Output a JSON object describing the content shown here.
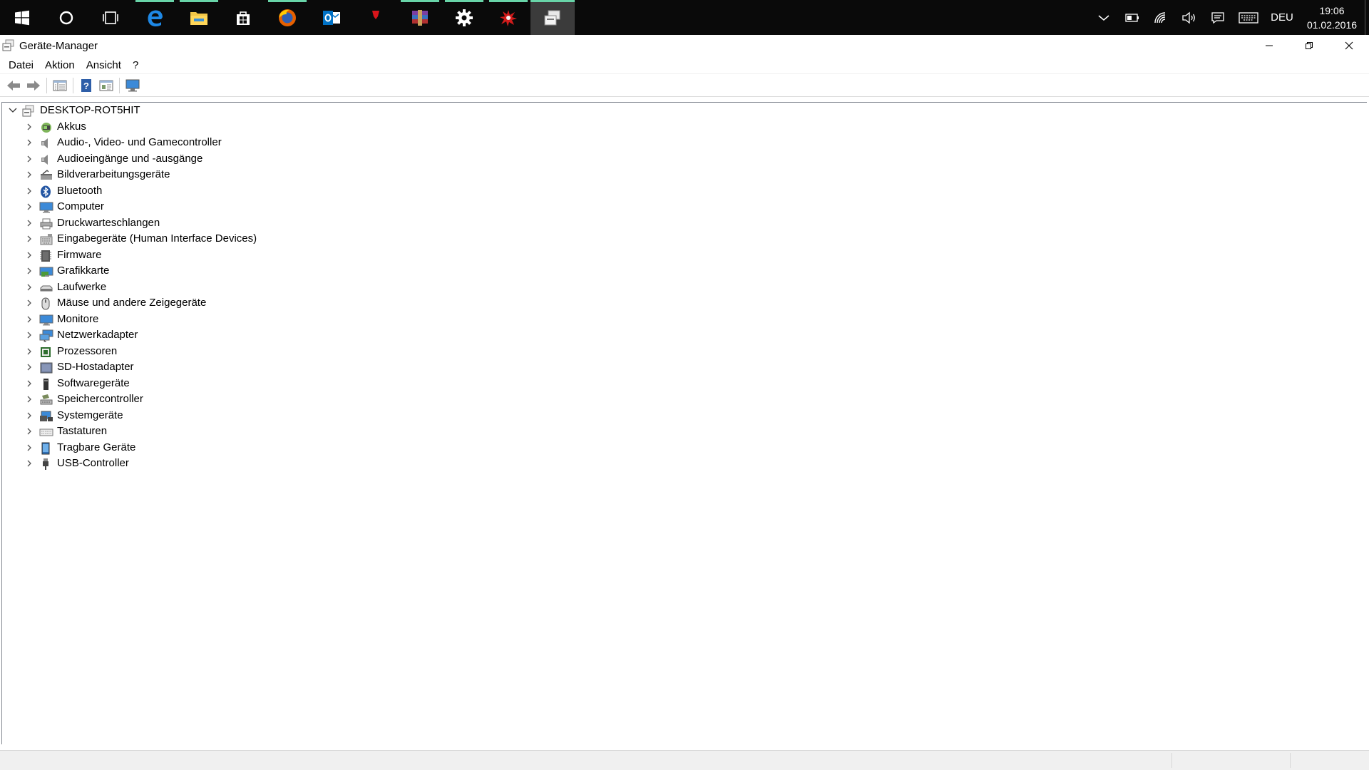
{
  "taskbar": {
    "buttons": [
      {
        "icon": "windows-start-icon",
        "running": false
      },
      {
        "icon": "cortana-search-icon",
        "running": false
      },
      {
        "icon": "task-view-icon",
        "running": false
      },
      {
        "icon": "edge-browser-icon",
        "running": true
      },
      {
        "icon": "file-explorer-icon",
        "running": true
      },
      {
        "icon": "store-icon",
        "running": false
      },
      {
        "icon": "firefox-icon",
        "running": true
      },
      {
        "icon": "outlook-icon",
        "running": false
      },
      {
        "icon": "red-shield-icon",
        "running": false
      },
      {
        "icon": "winrar-icon",
        "running": true
      },
      {
        "icon": "settings-gear-icon",
        "running": true
      },
      {
        "icon": "red-splash-app-icon",
        "running": true
      },
      {
        "icon": "device-manager-icon",
        "running": true,
        "active": true
      }
    ],
    "tray": {
      "language": "DEU",
      "time": "19:06",
      "date": "01.02.2016"
    }
  },
  "window": {
    "title": "Geräte-Manager",
    "menu": [
      "Datei",
      "Aktion",
      "Ansicht",
      "?"
    ]
  },
  "tree": {
    "root": "DESKTOP-ROT5HIT",
    "items": [
      {
        "label": "Akkus",
        "icon": "battery-icon"
      },
      {
        "label": "Audio-, Video- und Gamecontroller",
        "icon": "speaker-icon"
      },
      {
        "label": "Audioeingänge und -ausgänge",
        "icon": "speaker-icon"
      },
      {
        "label": "Bildverarbeitungsgeräte",
        "icon": "camera-scanner-icon"
      },
      {
        "label": "Bluetooth",
        "icon": "bluetooth-icon"
      },
      {
        "label": "Computer",
        "icon": "monitor-icon"
      },
      {
        "label": "Druckwarteschlangen",
        "icon": "printer-icon"
      },
      {
        "label": "Eingabegeräte (Human Interface Devices)",
        "icon": "hid-icon"
      },
      {
        "label": "Firmware",
        "icon": "firmware-icon"
      },
      {
        "label": "Grafikkarte",
        "icon": "display-adapter-icon"
      },
      {
        "label": "Laufwerke",
        "icon": "disk-drive-icon"
      },
      {
        "label": "Mäuse und andere Zeigegeräte",
        "icon": "mouse-icon"
      },
      {
        "label": "Monitore",
        "icon": "monitor-icon"
      },
      {
        "label": "Netzwerkadapter",
        "icon": "network-adapter-icon"
      },
      {
        "label": "Prozessoren",
        "icon": "processor-icon"
      },
      {
        "label": "SD-Hostadapter",
        "icon": "sd-host-icon"
      },
      {
        "label": "Softwaregeräte",
        "icon": "software-device-icon"
      },
      {
        "label": "Speichercontroller",
        "icon": "storage-controller-icon"
      },
      {
        "label": "Systemgeräte",
        "icon": "system-device-icon"
      },
      {
        "label": "Tastaturen",
        "icon": "keyboard-icon"
      },
      {
        "label": "Tragbare Geräte",
        "icon": "portable-device-icon"
      },
      {
        "label": "USB-Controller",
        "icon": "usb-icon"
      }
    ]
  }
}
